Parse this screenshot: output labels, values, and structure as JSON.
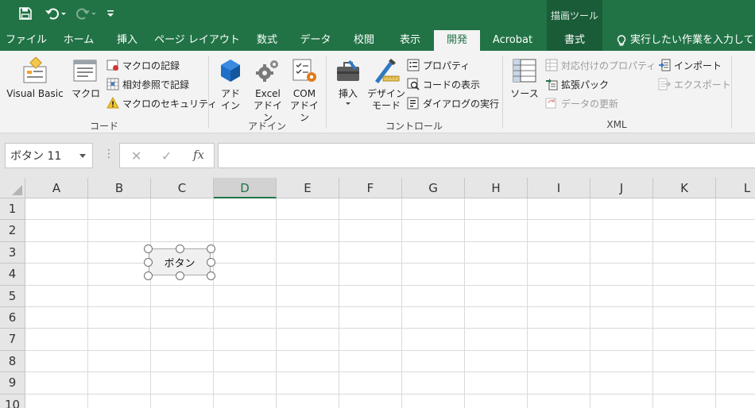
{
  "context_tab_title": "描画ツール",
  "tabs": [
    {
      "label": "ファイル",
      "active": false
    },
    {
      "label": "ホーム",
      "active": false
    },
    {
      "label": "挿入",
      "active": false
    },
    {
      "label": "ページ レイアウト",
      "active": false
    },
    {
      "label": "数式",
      "active": false
    },
    {
      "label": "データ",
      "active": false
    },
    {
      "label": "校閲",
      "active": false
    },
    {
      "label": "表示",
      "active": false
    },
    {
      "label": "開発",
      "active": true
    },
    {
      "label": "Acrobat",
      "active": false
    },
    {
      "label": "書式",
      "active": false
    }
  ],
  "tell_me": "実行したい作業を入力してくださ",
  "ribbon": {
    "code": {
      "label": "コード",
      "visual_basic": "Visual Basic",
      "macro": "マクロ",
      "record_macro": "マクロの記録",
      "relative_ref": "相対参照で記録",
      "macro_security": "マクロのセキュリティ"
    },
    "addins": {
      "label": "アドイン",
      "addin_line1": "アド",
      "addin_line2": "イン",
      "excel_line1": "Excel",
      "excel_line2": "アドイン",
      "com_line1": "COM",
      "com_line2": "アドイン"
    },
    "controls": {
      "label": "コントロール",
      "insert": "挿入",
      "design_line1": "デザイン",
      "design_line2": "モード",
      "properties": "プロパティ",
      "view_code": "コードの表示",
      "run_dialog": "ダイアログの実行"
    },
    "xml": {
      "label": "XML",
      "source": "ソース",
      "map_properties": "対応付けのプロパティ",
      "expansion_packs": "拡張パック",
      "refresh_data": "データの更新",
      "import": "インポート",
      "export": "エクスポート"
    }
  },
  "name_box": "ボタン 11",
  "formula_value": "",
  "columns": [
    "A",
    "B",
    "C",
    "D",
    "E",
    "F",
    "G",
    "H",
    "I",
    "J",
    "K",
    "L"
  ],
  "selected_column": "D",
  "rows": [
    "1",
    "2",
    "3",
    "4",
    "5",
    "6",
    "7",
    "8",
    "9",
    "10"
  ],
  "form_button_label": "ボタン",
  "colors": {
    "brand_green": "#217346",
    "ribbon_bg": "#f3f3f3",
    "header_bg": "#e6e6e6"
  }
}
